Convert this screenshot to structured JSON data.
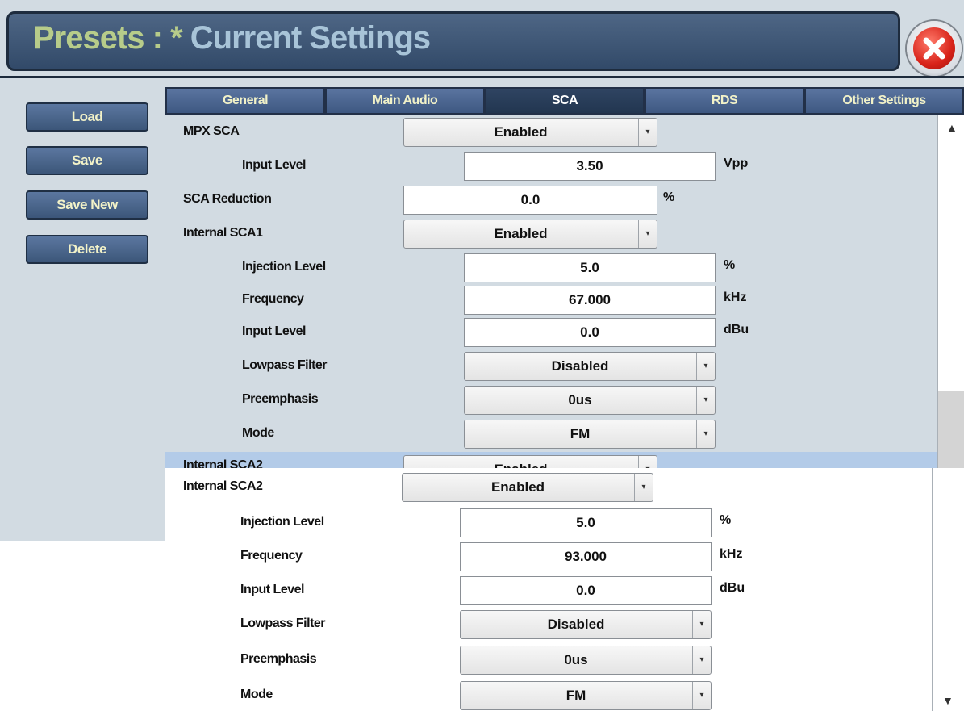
{
  "header": {
    "prefix": "Presets : *",
    "title": "Current Settings"
  },
  "sidebar": {
    "load": "Load",
    "save": "Save",
    "save_new": "Save New",
    "delete": "Delete"
  },
  "tabs": [
    "General",
    "Main Audio",
    "SCA",
    "RDS",
    "Other Settings"
  ],
  "active_tab": "SCA",
  "mpx": {
    "label": "MPX SCA",
    "value": "Enabled",
    "input_level_label": "Input Level",
    "input_level": "3.50",
    "input_level_unit": "Vpp"
  },
  "sca_reduction": {
    "label": "SCA Reduction",
    "value": "0.0",
    "unit": "%"
  },
  "sca1": {
    "label": "Internal SCA1",
    "value": "Enabled",
    "injection_label": "Injection Level",
    "injection": "5.0",
    "injection_unit": "%",
    "frequency_label": "Frequency",
    "frequency": "67.000",
    "frequency_unit": "kHz",
    "input_label": "Input Level",
    "input": "0.0",
    "input_unit": "dBu",
    "lowpass_label": "Lowpass Filter",
    "lowpass": "Disabled",
    "preemphasis_label": "Preemphasis",
    "preemphasis": "0us",
    "mode_label": "Mode",
    "mode": "FM"
  },
  "sca2": {
    "label": "Internal SCA2",
    "value": "Enabled",
    "injection_label": "Injection Level",
    "injection": "5.0",
    "injection_unit": "%",
    "frequency_label": "Frequency",
    "frequency": "93.000",
    "frequency_unit": "kHz",
    "input_label": "Input Level",
    "input": "0.0",
    "input_unit": "dBu",
    "lowpass_label": "Lowpass Filter",
    "lowpass": "Disabled",
    "preemphasis_label": "Preemphasis",
    "preemphasis": "0us",
    "mode_label": "Mode",
    "mode": "FM"
  },
  "scrollbar": {
    "up_glyph": "▲",
    "down_glyph": "▼",
    "dropdown_glyph": "▾"
  },
  "colors": {
    "header_bg": "#3f5878",
    "title_green": "#b7cc8a",
    "button_text": "#f2f2c8",
    "highlight": "#b3cbe8",
    "close_red": "#d8231a"
  }
}
